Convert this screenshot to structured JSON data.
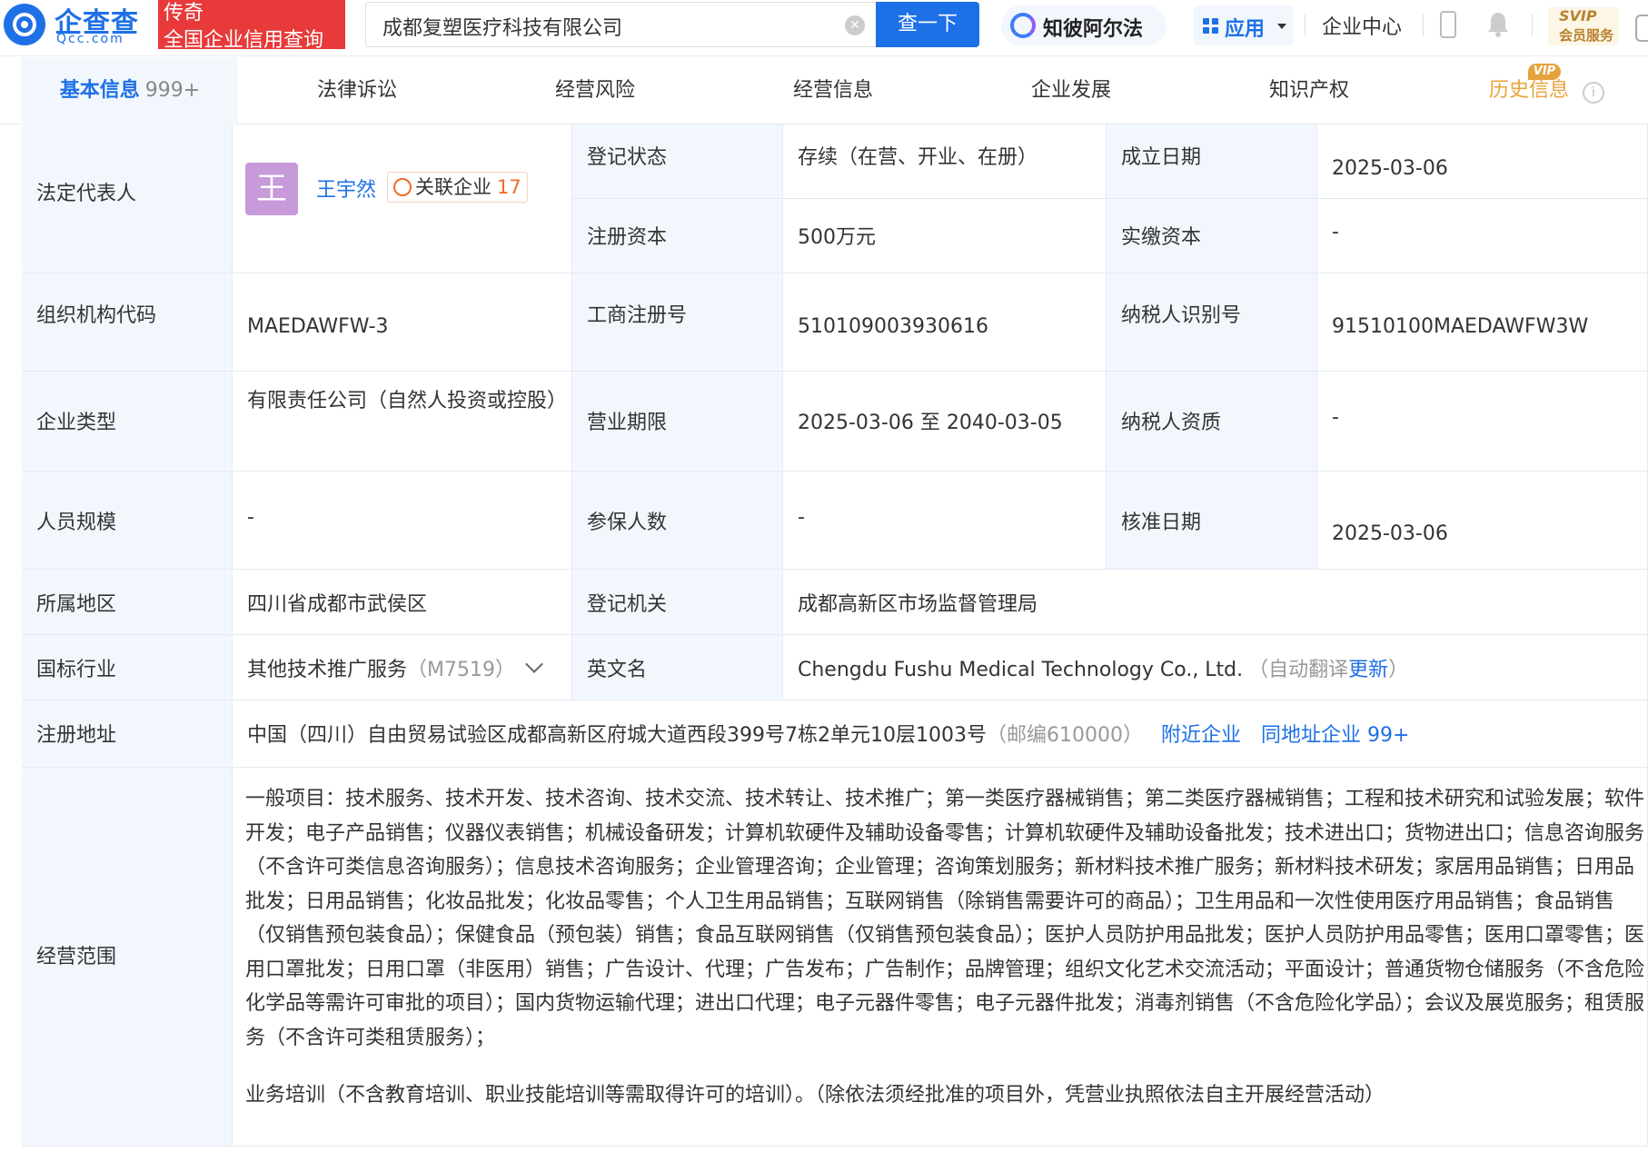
{
  "header": {
    "logo_cn": "企查查",
    "logo_en": "Qcc.com",
    "badge_line1": "传奇",
    "badge_line2": "全国企业信用查询",
    "search_value": "成都复塑医疗科技有限公司",
    "search_button": "查一下",
    "ai_label": "知彼阿尔法",
    "app_label": "应用",
    "enterprise_center": "企业中心",
    "svip_line1": "SVIP",
    "svip_line2": "会员服务"
  },
  "tabs": [
    {
      "label": "基本信息",
      "count": "999+"
    },
    {
      "label": "法律诉讼"
    },
    {
      "label": "经营风险"
    },
    {
      "label": "经营信息"
    },
    {
      "label": "企业发展"
    },
    {
      "label": "知识产权"
    },
    {
      "label": "历史信息",
      "tag": "VIP"
    }
  ],
  "info": {
    "legal_rep_label": "法定代表人",
    "legal_rep_avatar": "王",
    "legal_rep_name": "王宇然",
    "related_label": "关联企业",
    "related_count": "17",
    "reg_status_label": "登记状态",
    "reg_status": "存续（在营、开业、在册）",
    "found_date_label": "成立日期",
    "found_date": "2025-03-06",
    "reg_capital_label": "注册资本",
    "reg_capital": "500万元",
    "paid_capital_label": "实缴资本",
    "paid_capital": "-",
    "org_code_label": "组织机构代码",
    "org_code": "MAEDAWFW-3",
    "biz_reg_no_label": "工商注册号",
    "biz_reg_no": "510109003930616",
    "taxpayer_id_label": "纳税人识别号",
    "taxpayer_id": "91510100MAEDAWFW3W",
    "ent_type_label": "企业类型",
    "ent_type": "有限责任公司（自然人投资或控股）",
    "biz_term_label": "营业期限",
    "biz_term": "2025-03-06 至 2040-03-05",
    "taxpayer_qual_label": "纳税人资质",
    "taxpayer_qual": "-",
    "staff_size_label": "人员规模",
    "staff_size": "-",
    "insured_label": "参保人数",
    "insured": "-",
    "approve_date_label": "核准日期",
    "approve_date": "2025-03-06",
    "region_label": "所属地区",
    "region": "四川省成都市武侯区",
    "reg_authority_label": "登记机关",
    "reg_authority": "成都高新区市场监督管理局",
    "industry_label": "国标行业",
    "industry": "其他技术推广服务",
    "industry_code": "（M7519）",
    "en_name_label": "英文名",
    "en_name": "Chengdu Fushu Medical Technology Co., Ltd.",
    "en_name_note_pre": "（自动翻译",
    "en_name_update": "更新",
    "en_name_note_post": "）",
    "address_label": "注册地址",
    "address": "中国（四川）自由贸易试验区成都高新区府城大道西段399号7栋2单元10层1003号",
    "postcode": "（邮编610000）",
    "nearby_link": "附近企业",
    "same_addr_link": "同地址企业 99+",
    "scope_label": "经营范围",
    "scope_text": "一般项目：技术服务、技术开发、技术咨询、技术交流、技术转让、技术推广；第一类医疗器械销售；第二类医疗器械销售；工程和技术研究和试验发展；软件开发；电子产品销售；仪器仪表销售；机械设备研发；计算机软硬件及辅助设备零售；计算机软硬件及辅助设备批发；技术进出口；货物进出口；信息咨询服务（不含许可类信息咨询服务）；信息技术咨询服务；企业管理咨询；企业管理；咨询策划服务；新材料技术推广服务；新材料技术研发；家居用品销售；日用品批发；日用品销售；化妆品批发；化妆品零售；个人卫生用品销售；互联网销售（除销售需要许可的商品）；卫生用品和一次性使用医疗用品销售；食品销售（仅销售预包装食品）；保健食品（预包装）销售；食品互联网销售（仅销售预包装食品）；医护人员防护用品批发；医护人员防护用品零售；医用口罩零售；医用口罩批发；日用口罩（非医用）销售；广告设计、代理；广告发布；广告制作；品牌管理；组织文化艺术交流活动；平面设计；普通货物仓储服务（不含危险化学品等需许可审批的项目）；国内货物运输代理；进出口代理；电子元器件零售；电子元器件批发；消毒剂销售（不含危险化学品）；会议及展览服务；租赁服务（不含许可类租赁服务）；",
    "scope_text2": "业务培训（不含教育培训、职业技能培训等需取得许可的培训）。（除依法须经批准的项目外，凭营业执照依法自主开展经营活动）"
  },
  "colors": {
    "brand": "#1e70e6",
    "badge_red": "#e83a3a",
    "label_bg": "#f2f7fd",
    "vip_gold": "#e6a33d"
  }
}
